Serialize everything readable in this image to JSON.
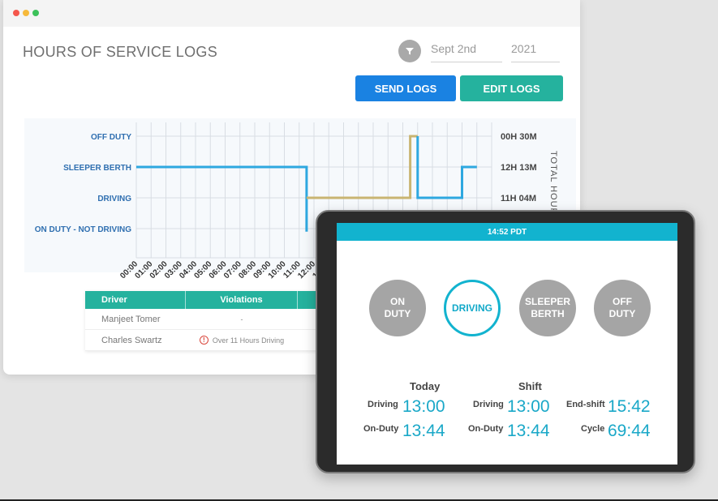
{
  "app": {
    "title": "HOURS OF SERVICE LOGS",
    "date_day": "Sept 2nd",
    "date_year": "2021",
    "send_label": "SEND LOGS",
    "edit_label": "EDIT LOGS"
  },
  "chart_data": {
    "type": "line",
    "y_categories": [
      "OFF DUTY",
      "SLEEPER BERTH",
      "DRIVING",
      "ON DUTY - NOT DRIVING"
    ],
    "x_ticks": [
      "00:00",
      "01:00",
      "02:00",
      "03:00",
      "04:00",
      "05:00",
      "06:00",
      "07:00",
      "08:00",
      "09:00",
      "10:00",
      "11:00",
      "12:00",
      "13:00"
    ],
    "right_labels": [
      "00H 30M",
      "12H 13M",
      "11H 04M"
    ],
    "right_axis_title": "TOTAL HOURS",
    "grid": true,
    "series": [
      {
        "color": "#2ea8e0",
        "points": [
          [
            0,
            1
          ],
          [
            11.5,
            1
          ],
          [
            11.5,
            3.1
          ]
        ]
      },
      {
        "color": "#c9b572",
        "points": [
          [
            11.5,
            2
          ],
          [
            18.5,
            2
          ],
          [
            18.5,
            0
          ],
          [
            19,
            0
          ]
        ]
      },
      {
        "color": "#2ea8e0",
        "points": [
          [
            19,
            0
          ],
          [
            19,
            2
          ],
          [
            22,
            2
          ],
          [
            22,
            1
          ],
          [
            23,
            1
          ]
        ]
      }
    ]
  },
  "table": {
    "headers": [
      "Driver",
      "Violations"
    ],
    "rows": [
      {
        "driver": "Manjeet Tomer",
        "violation": "-"
      },
      {
        "driver": "Charles Swartz",
        "violation": "Over 11 Hours Driving"
      }
    ]
  },
  "tablet": {
    "time": "14:52 PDT",
    "statuses": [
      {
        "line1": "ON",
        "line2": "DUTY"
      },
      {
        "line1": "DRIVING",
        "line2": ""
      },
      {
        "line1": "SLEEPER",
        "line2": "BERTH"
      },
      {
        "line1": "OFF",
        "line2": "DUTY"
      }
    ],
    "today_label": "Today",
    "shift_label": "Shift",
    "today_driving_label": "Driving",
    "today_driving": "13:00",
    "today_onduty_label": "On-Duty",
    "today_onduty": "13:44",
    "shift_driving_label": "Driving",
    "shift_driving": "13:00",
    "shift_onduty_label": "On-Duty",
    "shift_onduty": "13:44",
    "endshift_label": "End-shift",
    "endshift": "15:42",
    "cycle_label": "Cycle",
    "cycle": "69:44"
  }
}
